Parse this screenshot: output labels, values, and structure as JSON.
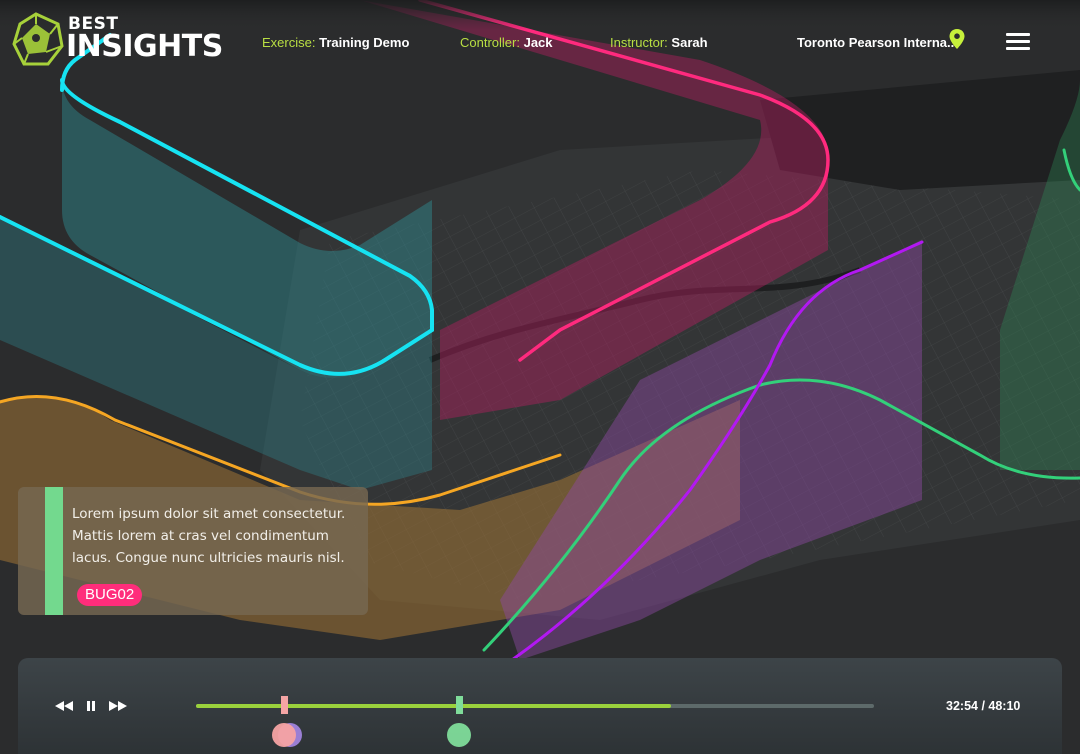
{
  "header": {
    "brand_top": "BEST",
    "brand_bottom": "INSIGHTS",
    "exercise_label": "Exercise:",
    "exercise_value": "Training Demo",
    "controller_label": "Controller:",
    "controller_value": "Jack",
    "instructor_label": "Instructor:",
    "instructor_value": "Sarah",
    "location": "Toronto Pearson Interna...",
    "icons": {
      "location": "map-pin-icon",
      "menu": "hamburger-menu-icon",
      "logo": "network-globe-icon"
    },
    "accent_color": "#b9df43"
  },
  "note": {
    "text": "Lorem ipsum dolor sit amet consectetur. Mattis lorem at cras vel condimentum lacus. Congue nunc ultricies mauris nisl.",
    "badge": "BUG02",
    "badge_color": "#ff2d7b",
    "accent_color": "#73d98e"
  },
  "player": {
    "current_time": "32:54",
    "total_time": "48:10",
    "time_display": "32:54 / 48:10",
    "progress_fraction": 0.7,
    "icons": {
      "rewind": "rewind-icon",
      "pause": "pause-icon",
      "fast_forward": "fast-forward-icon"
    },
    "markers": [
      {
        "color": "#f4a5a5",
        "fraction": 0.13
      },
      {
        "color": "#7fdc9a",
        "fraction": 0.388
      }
    ],
    "events": [
      {
        "color": "#ad8cf0",
        "fraction": 0.138
      },
      {
        "color": "#f6a3a3",
        "fraction": 0.13
      },
      {
        "color": "#7fdc9a",
        "fraction": 0.388
      }
    ]
  },
  "flight_paths": [
    {
      "name": "cyan",
      "color": "#16e3f2"
    },
    {
      "name": "pink",
      "color": "#ff2a7e"
    },
    {
      "name": "orange",
      "color": "#f5a623"
    },
    {
      "name": "green",
      "color": "#33d07a"
    },
    {
      "name": "purple",
      "color": "#b218f2"
    }
  ]
}
